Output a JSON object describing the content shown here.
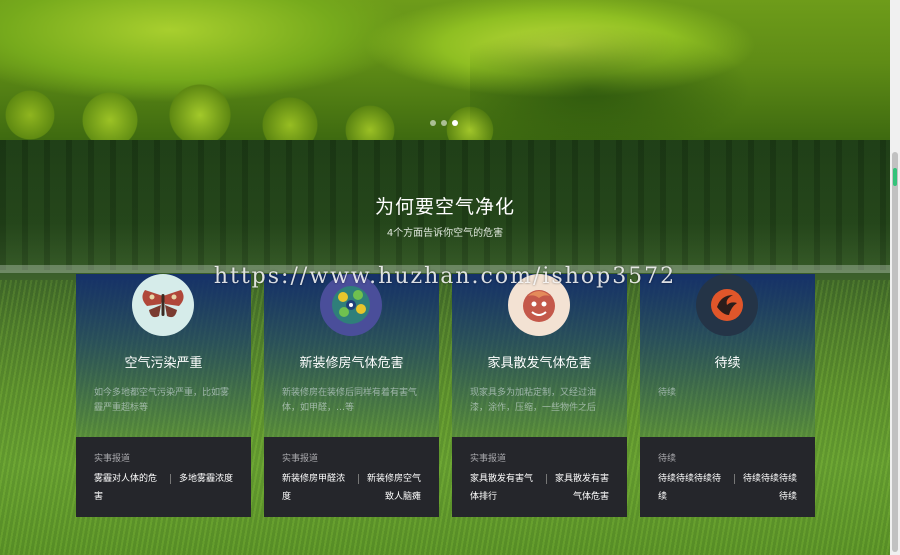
{
  "carousel": {
    "dot_count": 3,
    "active_index": 2
  },
  "section": {
    "title": "为何要空气净化",
    "subtitle": "4个方面告诉你空气的危害"
  },
  "watermark": "https://www.huzhan.com/ishop3572",
  "cards": [
    {
      "title": "空气污染严重",
      "desc": "如今多地都空气污染严重，比如雾霾严重超标等",
      "icon": "moth-icon",
      "news_label": "实事报道",
      "news_left": "雾霾对人体的危害",
      "news_right": "多地雾霾浓度"
    },
    {
      "title": "新装修房气体危害",
      "desc": "新装修房在装修后同样有着有害气体，如甲醛，…等",
      "icon": "peacock-icon",
      "news_label": "实事报道",
      "news_left": "新装修房甲醛浓度",
      "news_right": "新装修房空气致人脑瘫"
    },
    {
      "title": "家具散发气体危害",
      "desc": "现家具多为加粘定制，又经过油漆，涂作，压缩，一些物件之后",
      "icon": "creature-icon",
      "news_label": "实事报道",
      "news_left": "家具散发有害气体排行",
      "news_right": "家具散发有害气体危害"
    },
    {
      "title": "待续",
      "desc": "待续",
      "icon": "flame-icon",
      "news_label": "待续",
      "news_left": "待续待续待续待续",
      "news_right": "待续待续待续待续"
    }
  ]
}
